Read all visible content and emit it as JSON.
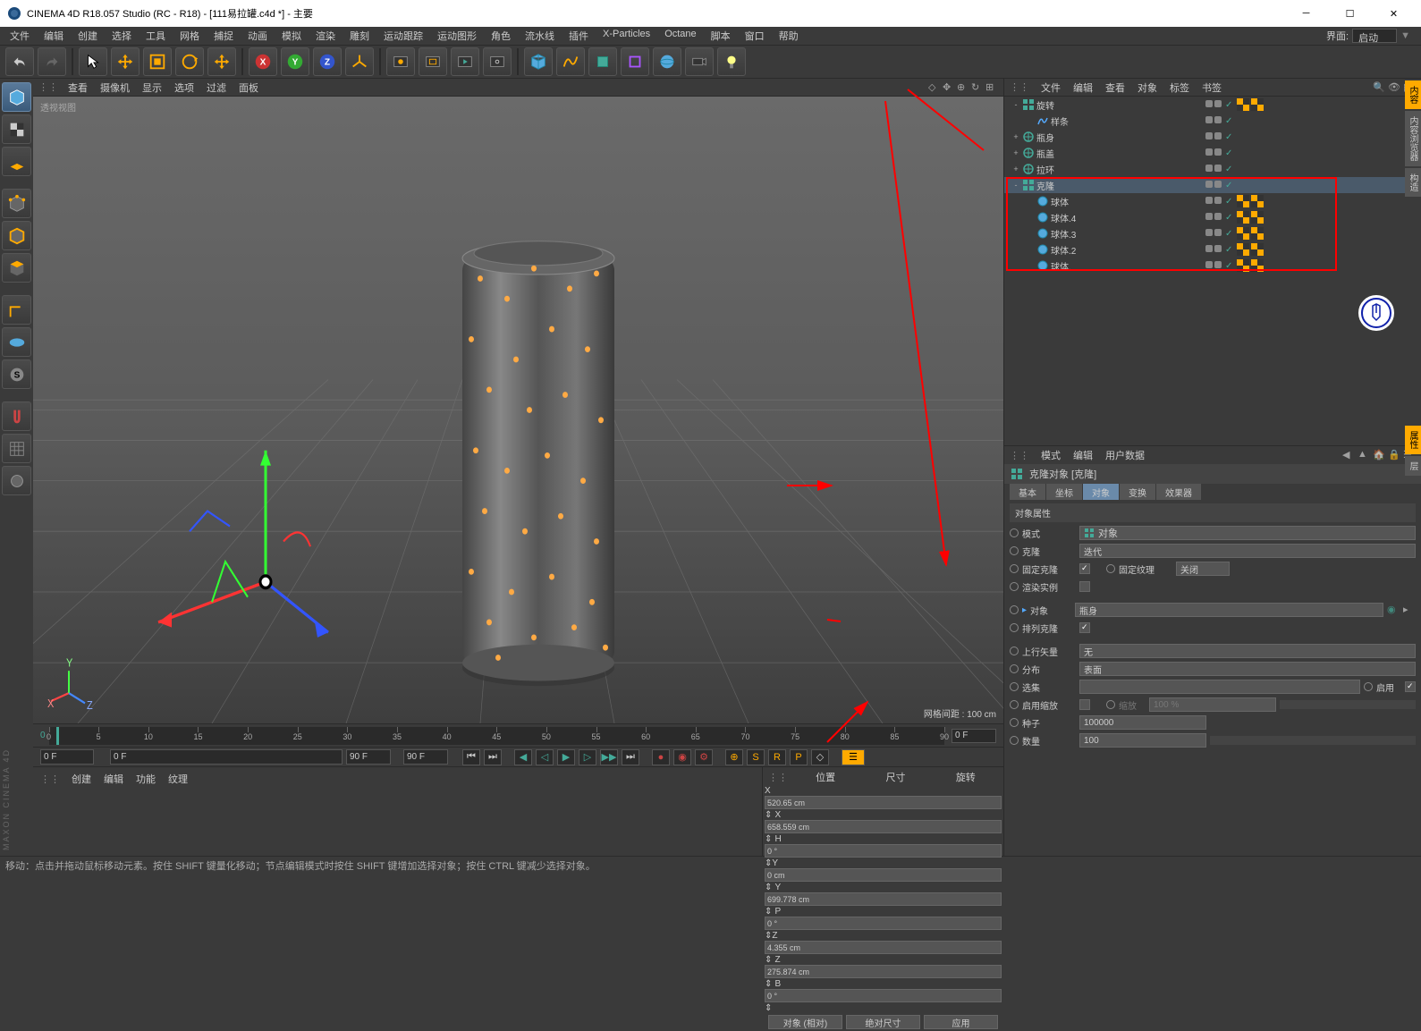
{
  "title": "CINEMA 4D R18.057 Studio (RC - R18) - [111易拉罐.c4d *] - 主要",
  "menubar": [
    "文件",
    "编辑",
    "创建",
    "选择",
    "工具",
    "网格",
    "捕捉",
    "动画",
    "模拟",
    "渲染",
    "雕刻",
    "运动跟踪",
    "运动图形",
    "角色",
    "流水线",
    "插件",
    "X-Particles",
    "Octane",
    "脚本",
    "窗口",
    "帮助"
  ],
  "interface_label": "界面:",
  "interface_value": "启动",
  "viewport_menu": [
    "查看",
    "摄像机",
    "显示",
    "选项",
    "过滤",
    "面板"
  ],
  "viewport_label": "透视视图",
  "viewport_info": "网格间距 : 100 cm",
  "timeline": {
    "start": "0",
    "end": "90 F",
    "current": "0 F",
    "field2": "0 F",
    "field3": "90 F",
    "field4": "90 F"
  },
  "timeline_ticks": [
    "0",
    "5",
    "10",
    "15",
    "20",
    "25",
    "30",
    "35",
    "40",
    "45",
    "50",
    "55",
    "60",
    "65",
    "70",
    "75",
    "80",
    "85",
    "90"
  ],
  "coord_menu": [
    "创建",
    "编辑",
    "功能",
    "纹理"
  ],
  "coord": {
    "headers": [
      "位置",
      "尺寸",
      "旋转"
    ],
    "rows": [
      {
        "axis": "X",
        "pos": "520.65 cm",
        "size": "658.559 cm",
        "rot": "0 °"
      },
      {
        "axis": "Y",
        "pos": "0 cm",
        "size": "699.778 cm",
        "rot": "0 °"
      },
      {
        "axis": "Z",
        "pos": "4.355 cm",
        "size": "275.874 cm",
        "rot": "0 °"
      }
    ],
    "btn1": "对象 (相对)",
    "btn2": "绝对尺寸",
    "btn3": "应用"
  },
  "statusbar": "移动：点击并拖动鼠标移动元素。按住 SHIFT 键量化移动；节点编辑模式时按住 SHIFT 键增加选择对象；按住 CTRL 键减少选择对象。",
  "obj_menu": [
    "文件",
    "编辑",
    "查看",
    "对象",
    "标签",
    "书签"
  ],
  "tree": [
    {
      "indent": 0,
      "expand": "-",
      "icon": "cloner",
      "color": "#4a9",
      "label": "旋转",
      "vis": "gg",
      "tags": [
        "c1",
        "c2"
      ]
    },
    {
      "indent": 1,
      "expand": "",
      "icon": "spline",
      "color": "#5af",
      "label": "样条",
      "vis": "gg",
      "tags": []
    },
    {
      "indent": 0,
      "expand": "+",
      "icon": "null",
      "color": "#4a9",
      "label": "瓶身",
      "vis": "gg",
      "tags": []
    },
    {
      "indent": 0,
      "expand": "+",
      "icon": "null",
      "color": "#4a9",
      "label": "瓶盖",
      "vis": "gg",
      "tags": []
    },
    {
      "indent": 0,
      "expand": "+",
      "icon": "null",
      "color": "#4a9",
      "label": "拉环",
      "vis": "gg",
      "tags": []
    },
    {
      "indent": 0,
      "expand": "-",
      "icon": "cloner",
      "color": "#4a9",
      "label": "克隆",
      "vis": "gg",
      "tags": [],
      "hl": true
    },
    {
      "indent": 1,
      "expand": "",
      "icon": "sphere",
      "color": "#5af",
      "label": "球体",
      "vis": "gg",
      "tags": [
        "t1",
        "t2"
      ]
    },
    {
      "indent": 1,
      "expand": "",
      "icon": "sphere",
      "color": "#5af",
      "label": "球体.4",
      "vis": "gg",
      "tags": [
        "t1",
        "t2"
      ]
    },
    {
      "indent": 1,
      "expand": "",
      "icon": "sphere",
      "color": "#5af",
      "label": "球体.3",
      "vis": "gg",
      "tags": [
        "t1",
        "t2"
      ]
    },
    {
      "indent": 1,
      "expand": "",
      "icon": "sphere",
      "color": "#5af",
      "label": "球体.2",
      "vis": "gg",
      "tags": [
        "t1",
        "t2"
      ]
    },
    {
      "indent": 1,
      "expand": "",
      "icon": "sphere",
      "color": "#5af",
      "label": "球体.",
      "vis": "gg",
      "tags": [
        "t1",
        "t2"
      ]
    }
  ],
  "attr_menu": [
    "模式",
    "编辑",
    "用户数据"
  ],
  "attr_title": "克隆对象 [克隆]",
  "attr_tabs": [
    "基本",
    "坐标",
    "对象",
    "变换",
    "效果器"
  ],
  "attr_active_tab": "对象",
  "attr_section": "对象属性",
  "attrs": {
    "mode_label": "模式",
    "mode_value": "对象",
    "clone_label": "克隆",
    "clone_value": "迭代",
    "fixclone_label": "固定克隆",
    "fixtex_label": "固定纹理",
    "fixtex_value": "关闭",
    "instance_label": "渲染实例",
    "object_label": "对象",
    "object_value": "瓶身",
    "arrange_label": "排列克隆",
    "upvec_label": "上行矢量",
    "upvec_value": "无",
    "dist_label": "分布",
    "dist_value": "表面",
    "select_label": "选集",
    "enable_label": "启用",
    "scale_label": "启用缩放",
    "scale2_label": "缩放",
    "scale_value": "100 %",
    "seed_label": "种子",
    "seed_value": "100000",
    "count_label": "数量",
    "count_value": "100"
  },
  "x_axis": "X",
  "y_axis": "Y",
  "z_axis": "Z",
  "h_label": "H",
  "p_label": "P",
  "b_label": "B"
}
